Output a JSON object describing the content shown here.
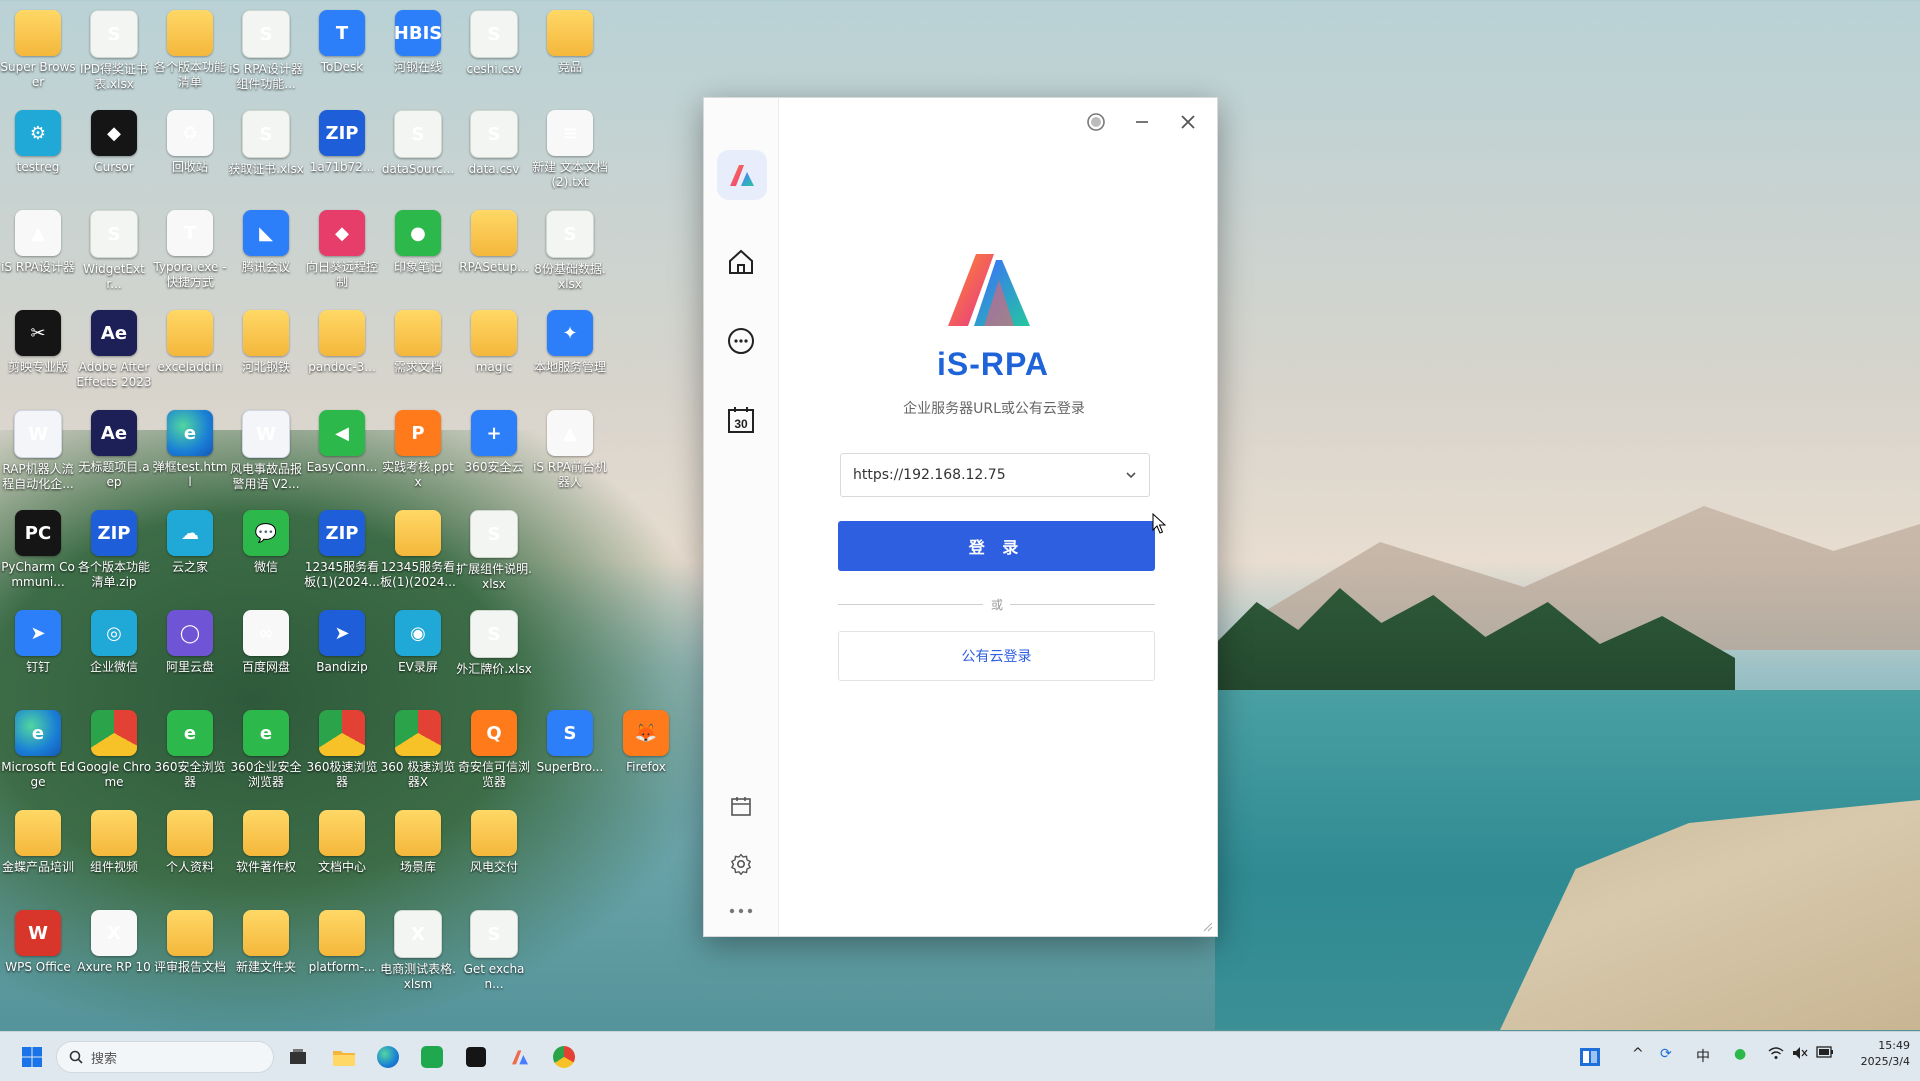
{
  "desktop": {
    "icons": [
      {
        "label": "Super Browser",
        "glyph": "",
        "style": "folder"
      },
      {
        "label": "IPD得奖证书表.xlsx",
        "glyph": "S",
        "style": "sheet"
      },
      {
        "label": "各个版本功能清单",
        "glyph": "",
        "style": "folder"
      },
      {
        "label": "iS RPA设计器组件功能...",
        "glyph": "S",
        "style": "sheet"
      },
      {
        "label": "ToDesk",
        "glyph": "T",
        "style": "blue"
      },
      {
        "label": "河钢在线",
        "glyph": "HBIS",
        "style": "blue"
      },
      {
        "label": "ceshi.csv",
        "glyph": "S",
        "style": "sheet"
      },
      {
        "label": "竞品",
        "glyph": "",
        "style": "folder"
      },
      {
        "label": "testreg",
        "glyph": "⚙",
        "style": "cyan"
      },
      {
        "label": "Cursor",
        "glyph": "◆",
        "style": "dark"
      },
      {
        "label": "回收站",
        "glyph": "♻",
        "style": "white"
      },
      {
        "label": "获取证书.xlsx",
        "glyph": "S",
        "style": "sheet"
      },
      {
        "label": "1a71b72...",
        "glyph": "ZIP",
        "style": "zip"
      },
      {
        "label": "dataSourc...",
        "glyph": "S",
        "style": "sheet"
      },
      {
        "label": "data.csv",
        "glyph": "S",
        "style": "sheet"
      },
      {
        "label": "新建 文本文档 (2).txt",
        "glyph": "≡",
        "style": "white"
      },
      {
        "label": "iS RPA设计器",
        "glyph": "▲",
        "style": "white"
      },
      {
        "label": "WidgetExtr...",
        "glyph": "S",
        "style": "sheet"
      },
      {
        "label": "Typora.exe - 快捷方式",
        "glyph": "T",
        "style": "white"
      },
      {
        "label": "腾讯会议",
        "glyph": "◣",
        "style": "blue"
      },
      {
        "label": "向日葵远程控制",
        "glyph": "◆",
        "style": "pink"
      },
      {
        "label": "印象笔记",
        "glyph": "●",
        "style": "green"
      },
      {
        "label": "RPASetup...",
        "glyph": "",
        "style": "folder"
      },
      {
        "label": "8份基础数据.xlsx",
        "glyph": "S",
        "style": "sheet"
      },
      {
        "label": "剪映专业版",
        "glyph": "✂",
        "style": "dark"
      },
      {
        "label": "Adobe After Effects 2023",
        "glyph": "Ae",
        "style": "ae"
      },
      {
        "label": "exceladdin",
        "glyph": "",
        "style": "folder"
      },
      {
        "label": "河北钢铁",
        "glyph": "",
        "style": "folder"
      },
      {
        "label": "pandoc-3...",
        "glyph": "",
        "style": "folder"
      },
      {
        "label": "需求文档",
        "glyph": "",
        "style": "folder"
      },
      {
        "label": "magic",
        "glyph": "",
        "style": "folder"
      },
      {
        "label": "本地服务管理",
        "glyph": "✦",
        "style": "blue"
      },
      {
        "label": "RAP机器人流程自动化企...",
        "glyph": "W",
        "style": "word"
      },
      {
        "label": "无标题项目.aep",
        "glyph": "Ae",
        "style": "ae"
      },
      {
        "label": "弹框test.html",
        "glyph": "e",
        "style": "edge"
      },
      {
        "label": "风电事故品报警用语 V2...",
        "glyph": "W",
        "style": "word"
      },
      {
        "label": "EasyConn...",
        "glyph": "◀",
        "style": "green"
      },
      {
        "label": "实践考核.pptx",
        "glyph": "P",
        "style": "orange"
      },
      {
        "label": "360安全云",
        "glyph": "+",
        "style": "blue"
      },
      {
        "label": "iS RPA前台机器人",
        "glyph": "▲",
        "style": "white"
      },
      {
        "label": "PyCharm Communi...",
        "glyph": "PC",
        "style": "dark"
      },
      {
        "label": "各个版本功能清单.zip",
        "glyph": "ZIP",
        "style": "zip"
      },
      {
        "label": "云之家",
        "glyph": "☁",
        "style": "cyan"
      },
      {
        "label": "微信",
        "glyph": "💬",
        "style": "green"
      },
      {
        "label": "12345服务看板(1)(2024...",
        "glyph": "ZIP",
        "style": "zip"
      },
      {
        "label": "12345服务看板(1)(2024...",
        "glyph": "",
        "style": "folder"
      },
      {
        "label": "扩展组件说明.xlsx",
        "glyph": "S",
        "style": "sheet"
      },
      {
        "label": "",
        "glyph": "",
        "style": "none"
      },
      {
        "label": "钉钉",
        "glyph": "➤",
        "style": "blue"
      },
      {
        "label": "企业微信",
        "glyph": "◎",
        "style": "cyan"
      },
      {
        "label": "阿里云盘",
        "glyph": "◯",
        "style": "purple"
      },
      {
        "label": "百度网盘",
        "glyph": "∞",
        "style": "white"
      },
      {
        "label": "Bandizip",
        "glyph": "➤",
        "style": "zip"
      },
      {
        "label": "EV录屏",
        "glyph": "◉",
        "style": "cyan"
      },
      {
        "label": "外汇牌价.xlsx",
        "glyph": "S",
        "style": "sheet"
      },
      {
        "label": "",
        "glyph": "",
        "style": "none"
      },
      {
        "label": "Microsoft Edge",
        "glyph": "e",
        "style": "edge"
      },
      {
        "label": "Google Chrome",
        "glyph": "",
        "style": "chrome"
      },
      {
        "label": "360安全浏览器",
        "glyph": "e",
        "style": "green"
      },
      {
        "label": "360企业安全浏览器",
        "glyph": "e",
        "style": "green"
      },
      {
        "label": "360极速浏览器",
        "glyph": "",
        "style": "chrome"
      },
      {
        "label": "360 极速浏览器X",
        "glyph": "",
        "style": "chrome"
      },
      {
        "label": "奇安信可信浏览器",
        "glyph": "Q",
        "style": "orange"
      },
      {
        "label": "SuperBro...",
        "glyph": "S",
        "style": "blue"
      },
      {
        "label": "Firefox",
        "glyph": "🦊",
        "style": "orange"
      },
      {
        "label": "金蝶产品培训",
        "glyph": "",
        "style": "folder"
      },
      {
        "label": "组件视频",
        "glyph": "",
        "style": "folder"
      },
      {
        "label": "个人资料",
        "glyph": "",
        "style": "folder"
      },
      {
        "label": "软件著作权",
        "glyph": "",
        "style": "folder"
      },
      {
        "label": "文档中心",
        "glyph": "",
        "style": "folder"
      },
      {
        "label": "场景库",
        "glyph": "",
        "style": "folder"
      },
      {
        "label": "风电交付",
        "glyph": "",
        "style": "folder"
      },
      {
        "label": "",
        "glyph": "",
        "style": "none"
      },
      {
        "label": "WPS Office",
        "glyph": "W",
        "style": "red"
      },
      {
        "label": "Axure RP 10",
        "glyph": "X",
        "style": "white"
      },
      {
        "label": "评审报告文档",
        "glyph": "",
        "style": "folder"
      },
      {
        "label": "新建文件夹",
        "glyph": "",
        "style": "folder"
      },
      {
        "label": "platform-...",
        "glyph": "",
        "style": "folder"
      },
      {
        "label": "电商测试表格.xlsm",
        "glyph": "X",
        "style": "sheet"
      },
      {
        "label": "Get exchan...",
        "glyph": "S",
        "style": "sheet"
      }
    ]
  },
  "app": {
    "brand_name": "iS-RPA",
    "subtitle": "企业服务器URL或公有云登录",
    "server_url": "https://192.168.12.75",
    "login_label": "登 录",
    "or_label": "或",
    "cloud_login_label": "公有云登录",
    "calendar_day": "30",
    "accent_color": "#2d5fe0"
  },
  "taskbar": {
    "search_placeholder": "搜索",
    "ime_label": "中",
    "time": "15:49",
    "date": "2025/3/4"
  }
}
